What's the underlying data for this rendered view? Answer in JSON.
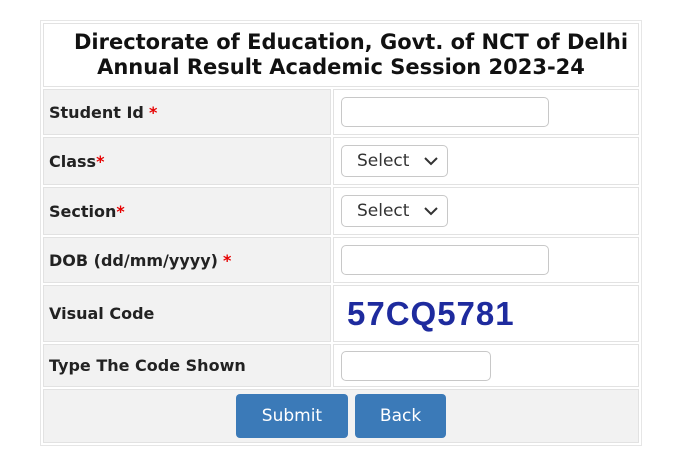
{
  "header": {
    "line1": "Directorate of Education, Govt. of NCT of Delhi",
    "line2": "Annual Result Academic Session 2023-24"
  },
  "fields": {
    "student_id": {
      "label": "Student Id",
      "required_mark": "*",
      "value": ""
    },
    "class": {
      "label": "Class",
      "required_mark": "*",
      "selected": "Select"
    },
    "section": {
      "label": "Section",
      "required_mark": "*",
      "selected": "Select"
    },
    "dob": {
      "label": "DOB (dd/mm/yyyy)",
      "required_mark": "*",
      "value": ""
    },
    "visual_code": {
      "label": "Visual Code",
      "code": "57CQ5781"
    },
    "typed_code": {
      "label": "Type The Code Shown",
      "value": ""
    }
  },
  "buttons": {
    "submit": "Submit",
    "back": "Back"
  },
  "colors": {
    "required": "#e60000",
    "button_bg": "#3b7ab8",
    "captcha_text": "#1e2b9e",
    "label_bg": "#f2f2f2"
  }
}
